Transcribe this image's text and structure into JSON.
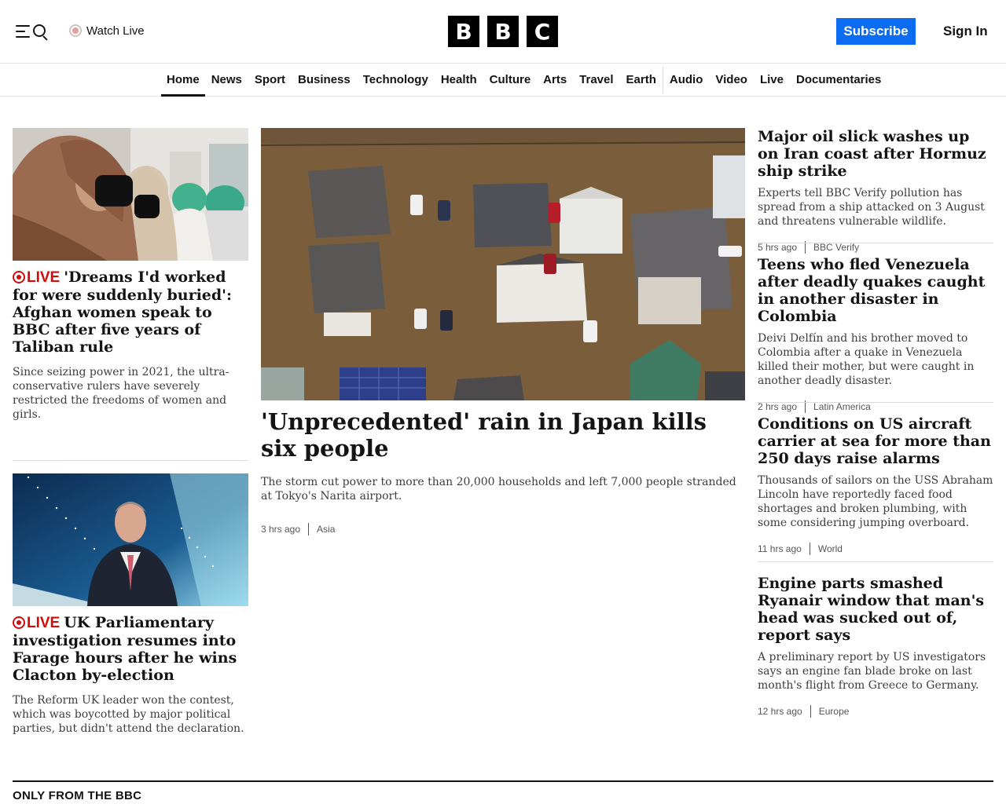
{
  "header": {
    "watch_live_label": "Watch Live",
    "logo_letters": [
      "B",
      "B",
      "C"
    ],
    "subscribe_label": "Subscribe",
    "signin_label": "Sign In",
    "colors": {
      "subscribe_bg": "#0b6cf1",
      "live_red": "#d00c0c"
    }
  },
  "nav": {
    "items": [
      {
        "label": "Home",
        "active": true
      },
      {
        "label": "News"
      },
      {
        "label": "Sport"
      },
      {
        "label": "Business"
      },
      {
        "label": "Technology"
      },
      {
        "label": "Health"
      },
      {
        "label": "Culture"
      },
      {
        "label": "Arts"
      },
      {
        "label": "Travel"
      },
      {
        "label": "Earth"
      },
      {
        "label": "Audio"
      },
      {
        "label": "Video"
      },
      {
        "label": "Live"
      },
      {
        "label": "Documentaries"
      }
    ]
  },
  "left_stories": [
    {
      "live_label": "LIVE",
      "title": "'Dreams I'd worked for were suddenly buried': Afghan women speak to BBC after five years of Taliban rule",
      "summary": "Since seizing power in 2021, the ultra-conservative rulers have severely restricted the freedoms of women and girls."
    },
    {
      "live_label": "LIVE",
      "title": "UK Parliamentary investigation resumes into Farage hours after he wins Clacton by-election",
      "summary": "The Reform UK leader won the contest, which was boycotted by major political parties, but didn't attend the declaration."
    }
  ],
  "main_story": {
    "title": "'Unprecedented' rain in Japan kills six people",
    "summary": "The storm cut power to more than 20,000 households and left 7,000 people stranded at Tokyo's Narita airport.",
    "time": "3 hrs ago",
    "section": "Asia"
  },
  "right_stories": [
    {
      "title": "Major oil slick washes up on Iran coast after Hormuz ship strike",
      "summary": "Experts tell BBC Verify pollution has spread from a ship attacked on 3 August and threatens vulnerable wildlife.",
      "time": "5 hrs ago",
      "section": "BBC Verify"
    },
    {
      "title": "Teens who fled Venezuela after deadly quakes caught in another disaster in Colombia",
      "summary": "Deivi Delfín and his brother moved to Colombia after a quake in Venezuela killed their mother, but were caught in another deadly disaster.",
      "time": "2 hrs ago",
      "section": "Latin America"
    },
    {
      "title": "Conditions on US aircraft carrier at sea for more than 250 days raise alarms",
      "summary": "Thousands of sailors on the USS Abraham Lincoln have reportedly faced food shortages and broken plumbing, with some considering jumping overboard.",
      "time": "11 hrs ago",
      "section": "World"
    },
    {
      "title": "Engine parts smashed Ryanair window that man's head was sucked out of, report says",
      "summary": "A preliminary report by US investigators says an engine fan blade broke on last month's flight from Greece to Germany.",
      "time": "12 hrs ago",
      "section": "Europe"
    }
  ],
  "section_heading": "ONLY FROM THE BBC"
}
